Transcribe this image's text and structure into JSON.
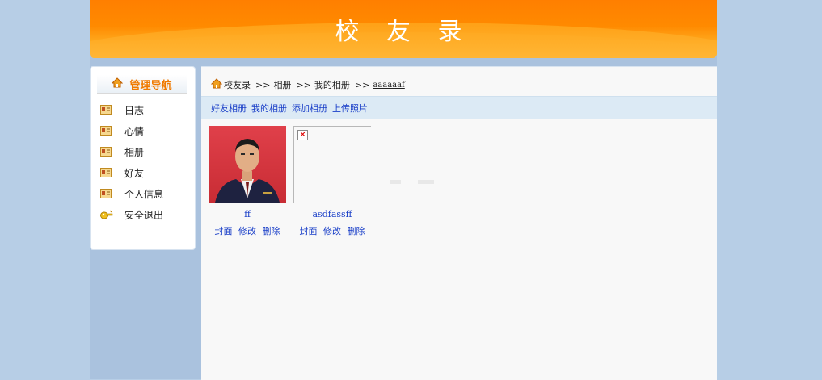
{
  "header": {
    "title": "校 友 录"
  },
  "sidebar": {
    "title": "管理导航",
    "items": [
      {
        "label": "日志",
        "icon": "profile-card-icon"
      },
      {
        "label": "心情",
        "icon": "profile-card-icon"
      },
      {
        "label": "相册",
        "icon": "profile-card-icon"
      },
      {
        "label": "好友",
        "icon": "profile-card-icon"
      },
      {
        "label": "个人信息",
        "icon": "profile-card-icon"
      },
      {
        "label": "安全退出",
        "icon": "exit-key-icon"
      }
    ]
  },
  "breadcrumb": {
    "home": "校友录",
    "items": [
      ">>",
      "相册",
      ">>",
      "我的相册",
      ">>",
      "aaaaaaf"
    ]
  },
  "subnav": [
    "好友相册",
    "我的相册",
    "添加相册",
    "上传照片"
  ],
  "albums": [
    {
      "name": "ff",
      "actions": [
        "封面",
        "修改",
        "删除"
      ]
    },
    {
      "name": "asdfassff",
      "actions": [
        "封面",
        "修改",
        "删除"
      ]
    }
  ],
  "colors": {
    "accent": "#ff7f00",
    "link": "#1a3fc8",
    "background": "#b7cee6"
  }
}
